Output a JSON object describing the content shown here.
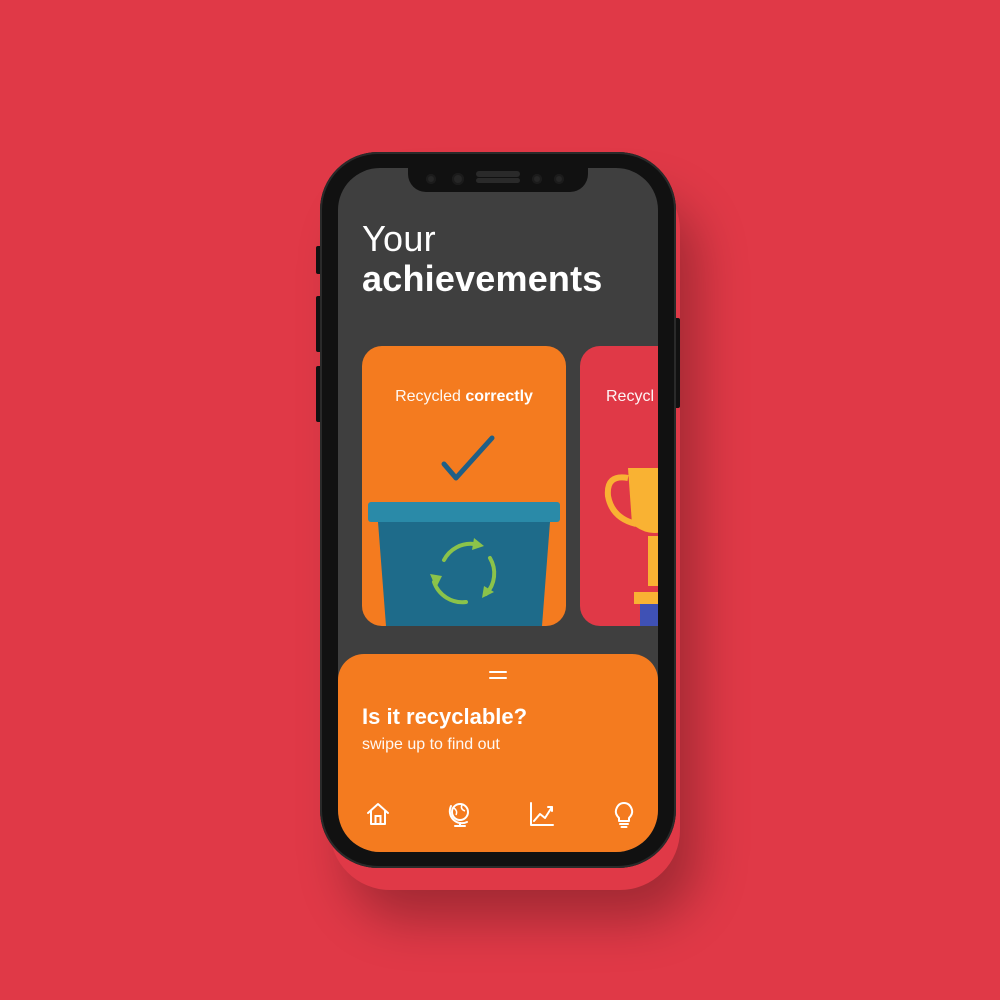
{
  "header": {
    "title_line1": "Your",
    "title_line2": "achievements"
  },
  "cards": [
    {
      "label_light": "Recycled",
      "label_bold": "correctly",
      "illustration": "recycle-bin-checkmark",
      "color": "#f47b1f"
    },
    {
      "label_light": "Recycl",
      "illustration": "trophy",
      "color": "#e03947"
    }
  ],
  "sheet": {
    "title": "Is it recyclable?",
    "subtitle": "swipe up to find out",
    "color": "#f47b1f"
  },
  "tabbar": {
    "items": [
      {
        "icon": "home-icon"
      },
      {
        "icon": "globe-icon"
      },
      {
        "icon": "chart-icon"
      },
      {
        "icon": "lightbulb-icon"
      }
    ]
  },
  "colors": {
    "background": "#e03947",
    "screen": "#3f3f3f",
    "accent": "#f47b1f",
    "bin": "#1e6b8a",
    "bin_lid": "#2a8aa8",
    "recycle_arrows": "#8bc34a",
    "checkmark": "#1f5f86",
    "trophy": "#f9b233"
  }
}
